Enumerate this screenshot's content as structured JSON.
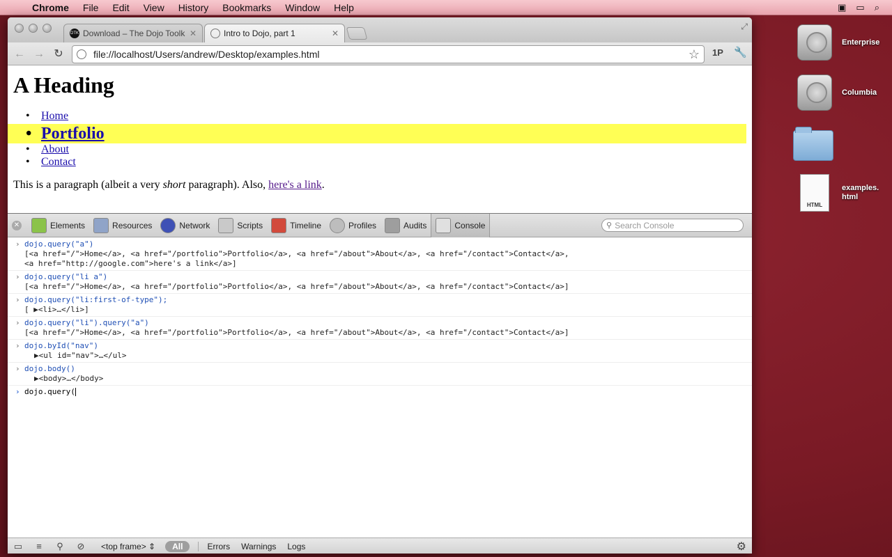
{
  "menubar": {
    "app": "Chrome",
    "items": [
      "File",
      "Edit",
      "View",
      "History",
      "Bookmarks",
      "Window",
      "Help"
    ]
  },
  "desktop_icons": [
    {
      "label": "Enterprise",
      "icon": "hard-drive-icon"
    },
    {
      "label": "Columbia",
      "icon": "hard-drive-icon"
    },
    {
      "label": "",
      "icon": "folder-icon"
    },
    {
      "label": "examples.\nhtml",
      "icon": "html-file-icon",
      "badge": "HTML"
    }
  ],
  "tabs": [
    {
      "title": "Download – The Dojo Toolkit",
      "favicon": "DTK",
      "active": false
    },
    {
      "title": "Intro to Dojo, part 1",
      "active": true
    }
  ],
  "omnibox": {
    "url": "file://localhost/Users/andrew/Desktop/examples.html"
  },
  "toolbar_extras": {
    "onepass": "1P"
  },
  "page": {
    "heading": "A Heading",
    "nav": [
      "Home",
      "Portfolio",
      "About",
      "Contact"
    ],
    "paragraph": {
      "pre": "This is a paragraph (albeit a very ",
      "em": "short",
      "mid": " paragraph). Also, ",
      "link": "here's a link",
      "post": "."
    }
  },
  "devtools": {
    "tabs": [
      "Elements",
      "Resources",
      "Network",
      "Scripts",
      "Timeline",
      "Profiles",
      "Audits",
      "Console"
    ],
    "active_tab": "Console",
    "search_placeholder": "Search Console",
    "console": [
      {
        "cmd": "dojo.query(\"a\")",
        "res": [
          "[<a href=\"/\">Home</a>, <a href=\"/portfolio\">Portfolio</a>, <a href=\"/about\">About</a>, <a href=\"/contact\">Contact</a>,",
          "<a href=\"http://google.com\">here's a link</a>]"
        ]
      },
      {
        "cmd": "dojo.query(\"li a\")",
        "res": [
          "[<a href=\"/\">Home</a>, <a href=\"/portfolio\">Portfolio</a>, <a href=\"/about\">About</a>, <a href=\"/contact\">Contact</a>]"
        ]
      },
      {
        "cmd": "dojo.query(\"li:first-of-type\");",
        "res": [
          "[ ▶<li>…</li>]"
        ]
      },
      {
        "cmd": "dojo.query(\"li\").query(\"a\")",
        "res": [
          "[<a href=\"/\">Home</a>, <a href=\"/portfolio\">Portfolio</a>, <a href=\"/about\">About</a>, <a href=\"/contact\">Contact</a>]"
        ]
      },
      {
        "cmd": "dojo.byId(\"nav\")",
        "res": [
          "▶<ul id=\"nav\">…</ul>"
        ]
      },
      {
        "cmd": "dojo.body()",
        "res": [
          "▶<body>…</body>"
        ]
      }
    ],
    "prompt": "dojo.query(",
    "status": {
      "frame": "<top frame>",
      "filters": [
        "All",
        "Errors",
        "Warnings",
        "Logs"
      ]
    }
  }
}
